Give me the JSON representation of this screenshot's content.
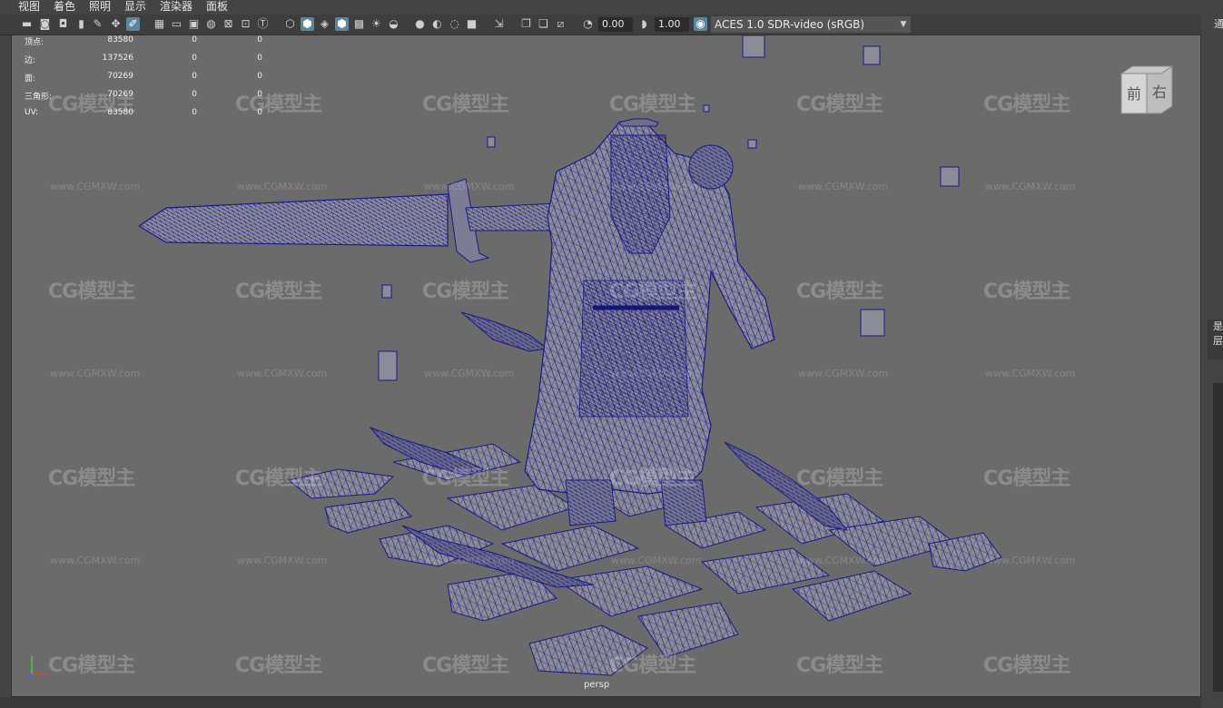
{
  "menu": {
    "items": [
      "视图",
      "着色",
      "照明",
      "显示",
      "渲染器",
      "面板"
    ]
  },
  "toolbar": {
    "exposure_value": "0.00",
    "gamma_value": "1.00",
    "color_space": "ACES 1.0 SDR-video (sRGB)"
  },
  "hud": {
    "rows": [
      {
        "label": "顶点:",
        "v1": "83580",
        "v2": "0",
        "v3": "0"
      },
      {
        "label": "边:",
        "v1": "137526",
        "v2": "0",
        "v3": "0"
      },
      {
        "label": "面:",
        "v1": "70269",
        "v2": "0",
        "v3": "0"
      },
      {
        "label": "三角形:",
        "v1": "70269",
        "v2": "0",
        "v3": "0"
      },
      {
        "label": "UV:",
        "v1": "83580",
        "v2": "0",
        "v3": "0"
      }
    ]
  },
  "viewcube": {
    "front": "前",
    "right": "右"
  },
  "camera_label": "persp",
  "watermark": {
    "logo": "CG模型主",
    "url": "www.CGMXW.com"
  },
  "right_panel": {
    "top_char": "通",
    "tab_char_1": "是",
    "tab_char_2": "层"
  },
  "colors": {
    "wire": "#1a1a8a",
    "viewport_bg": "#6b6b6b",
    "mesh_fill": "#8a8a8f"
  }
}
